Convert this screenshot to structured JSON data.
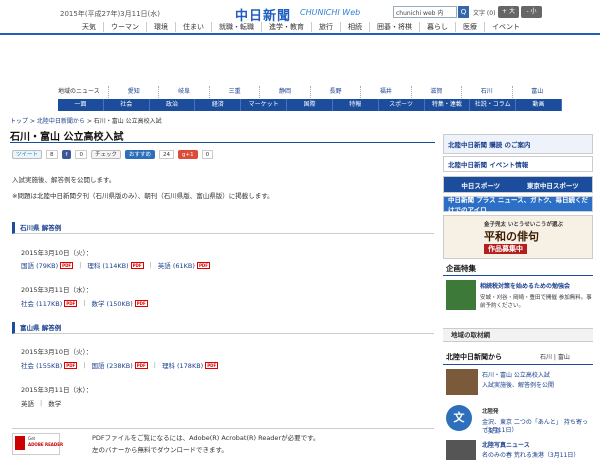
{
  "header": {
    "date": "2015年(平成27年)3月11日(水)",
    "logo": "中日新聞",
    "logo_sub": "CHUNICHI Web",
    "search_placeholder": "chunichi web 内",
    "search_button": "Q",
    "text_size_label": "文字 (0)",
    "text_bigger": "+ 大",
    "text_smaller": "- 小",
    "nav": [
      "天気",
      "ウーマン",
      "環境",
      "住まい",
      "就職・転職",
      "進学・教育",
      "旅行",
      "相続",
      "囲碁・将棋",
      "暮らし",
      "医療",
      "イベント"
    ]
  },
  "region_nav": {
    "label": "地域のニュース",
    "items": [
      "愛知",
      "岐阜",
      "三重",
      "静岡",
      "長野",
      "福井",
      "滋賀",
      "石川",
      "富山"
    ]
  },
  "category_nav": [
    "一面",
    "社会",
    "政治",
    "経済",
    "マーケット",
    "国際",
    "特報",
    "スポーツ",
    "特集・連載",
    "社説・コラム",
    "動画"
  ],
  "breadcrumb": {
    "home": "トップ",
    "parent": "北陸中日新聞から",
    "current": "石川・富山 公立高校入試"
  },
  "article": {
    "title": "石川・富山 公立高校入試",
    "social": {
      "tweet": "ツイート",
      "tweet_count": "8",
      "fb_count": "0",
      "check": "チェック",
      "osusume": "おすすめ",
      "osusume_count": "24",
      "gplus": "g+1",
      "gplus_count": "0"
    },
    "intro1": "入試実施後、解答例を公開します。",
    "intro2": "※問題は北陸中日新聞夕刊（石川県版のみ）、朝刊（石川県版、富山県版）に掲載します。",
    "ishikawa": {
      "heading": "石川県 解答例",
      "day1": "2015年3月10日（火）：",
      "day1_files": [
        "国語 (79KB)",
        "理科 (114KB)",
        "英語 (61KB)"
      ],
      "day2": "2015年3月11日（水）：",
      "day2_files": [
        "社会 (117KB)",
        "数学 (150KB)"
      ]
    },
    "toyama": {
      "heading": "富山県 解答例",
      "day1": "2015年3月10日（火）：",
      "day1_files": [
        "社会 (155KB)",
        "国語 (238KB)",
        "理科 (178KB)"
      ],
      "day2": "2015年3月11日（水）：",
      "day2_files": [
        "英語",
        "数学"
      ]
    },
    "pdf_badge": "PDF",
    "reader_logo_top": "Get",
    "reader_logo_bottom": "ADOBE READER",
    "pdf_note1": "PDFファイルをご覧になるには、Adobe(R) Acrobat(R) Readerが必要です。",
    "pdf_note2": "左のバナーから無料でダウンロードできます。"
  },
  "sidebar": {
    "b1": "北陸中日新聞 購読 のご案内",
    "b2": "北陸中日新聞 イベント情報",
    "b3_left": "中日スポーツ",
    "b3_right": "東京中日スポーツ",
    "b4": "中日新聞 プラス ニュース、ガトク、毎日続くだけでのアイロ",
    "b5_top": "金子兜太 いとうせいこうが選ぶ",
    "b5_big": "平和の俳句",
    "b5_red": "作品募集中",
    "kikaku_head": "企画特集",
    "kikaku_title": "相続税対策を始めるための勉強会",
    "kikaku_desc": "安城・刈谷・岡崎・豊田で開催 参加無料。事前予約ください。",
    "chiiki": "地域の取材網",
    "hk_head": "北陸中日新聞から",
    "hk_head_right": "石川 | 富山",
    "hk_t1": "石川・富山 公立高校入試",
    "hk_t2": "入試実施後、解答例を公開",
    "hk_circle": "文",
    "hk_label1": "北陸発",
    "hk_item1": "金沢、東京 二つの「あんと」 持ち寄って交流",
    "hk_item1b": "（3月11日）",
    "hk_label2": "北陸写真ニュース",
    "hk_item2": "名のみの春 荒れる漁港（3月11日）"
  }
}
